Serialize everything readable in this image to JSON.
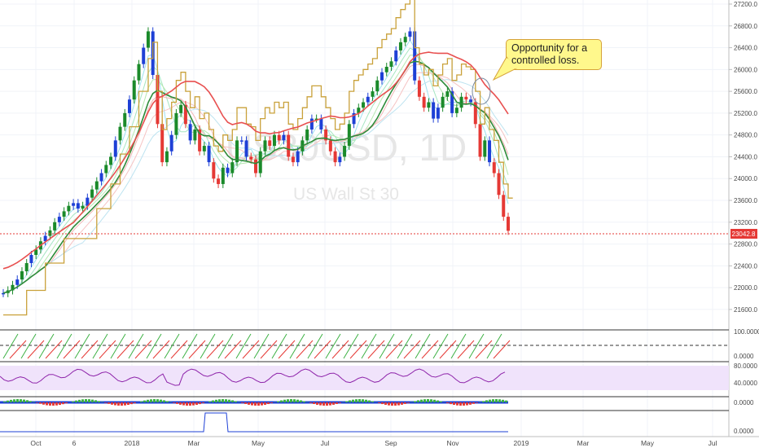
{
  "chart_data": {
    "type": "candlestick",
    "watermark": {
      "symbol": "US30USD, 1D",
      "name": "US Wall St 30"
    },
    "price_axis": {
      "ylim": [
        21300,
        27200
      ],
      "ticks": [
        "27200.0",
        "26800.0",
        "26400.0",
        "26000.0",
        "25600.0",
        "25200.0",
        "24800.0",
        "24400.0",
        "24000.0",
        "23600.0",
        "23200.0",
        "22800.0",
        "22400.0",
        "22000.0",
        "21600.0"
      ]
    },
    "last_price": "23042.8",
    "x_axis": {
      "ticks": [
        "Oct",
        "6",
        "2018",
        "Mar",
        "May",
        "Jul",
        "Sep",
        "Nov",
        "2019",
        "Mar",
        "May",
        "Jul"
      ]
    },
    "close_series": [
      21900,
      21950,
      22050,
      22150,
      22300,
      22450,
      22600,
      22700,
      22850,
      22950,
      23050,
      23200,
      23300,
      23400,
      23500,
      23550,
      23450,
      23500,
      23650,
      23800,
      23950,
      24100,
      24250,
      24400,
      24700,
      24950,
      25200,
      25450,
      25800,
      26100,
      26400,
      26700,
      25900,
      25000,
      24300,
      24500,
      24800,
      25200,
      25350,
      25000,
      24700,
      24900,
      24500,
      24600,
      24300,
      24000,
      23900,
      24200,
      24100,
      24300,
      24700,
      24700,
      24400,
      24350,
      24100,
      24500,
      24700,
      24600,
      24800,
      24700,
      24800,
      24400,
      24300,
      24500,
      24700,
      24900,
      25100,
      25100,
      24900,
      24700,
      24500,
      24300,
      24400,
      24600,
      25000,
      25200,
      25300,
      25400,
      25500,
      25600,
      25800,
      25950,
      26050,
      26150,
      26350,
      26500,
      26600,
      26700,
      25800,
      25500,
      25300,
      25400,
      25100,
      25300,
      25500,
      25600,
      25200,
      25300,
      25500,
      25450,
      25400,
      25000,
      24400,
      24700,
      24300,
      24100,
      23700,
      23300,
      23042.8
    ],
    "annotation": "Opportunity for a controlled loss.",
    "indicator_ticks": {
      "stochastic": [
        "100.0000",
        "0.0000"
      ],
      "rsi": [
        "80.0000",
        "40.0000"
      ],
      "histogram": [
        "0.0000"
      ],
      "volume": [
        "0.0000"
      ]
    }
  }
}
